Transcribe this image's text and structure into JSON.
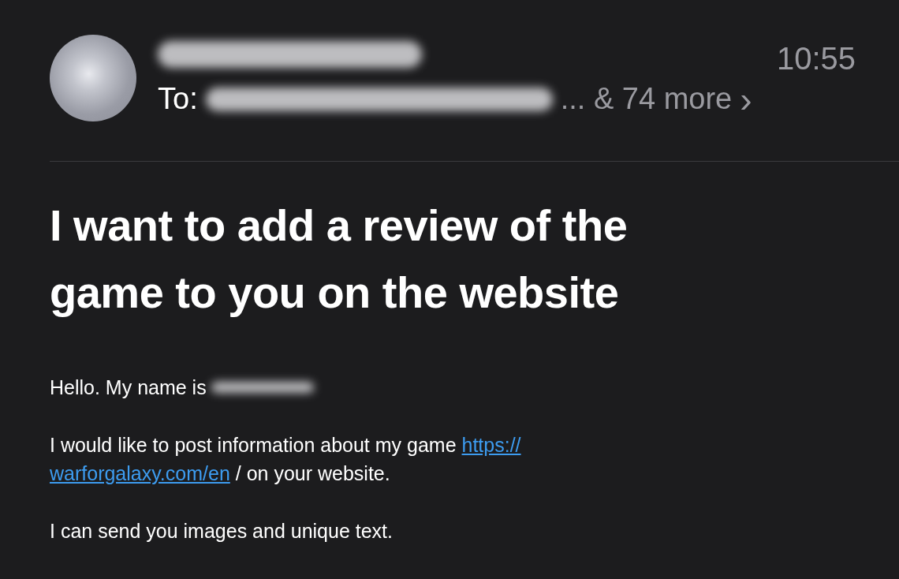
{
  "header": {
    "sender": {
      "redacted": true
    },
    "time": "10:55",
    "to_label": "To:",
    "recipients_redacted": true,
    "more": "... & 74 more",
    "chevron": "›"
  },
  "subject": "I want to add a review of the game to you on the website",
  "body": [
    {
      "kind": "text",
      "text": "Hello. My name is",
      "redacted": true
    },
    {
      "kind": "link",
      "text": "I would like to post information about my game",
      "link_lines": [
        "https://",
        "warforgalaxy.com/en"
      ],
      "after": "/ on your website."
    },
    {
      "kind": "text",
      "text": "I can send you images and unique text.",
      "redacted": false
    }
  ]
}
